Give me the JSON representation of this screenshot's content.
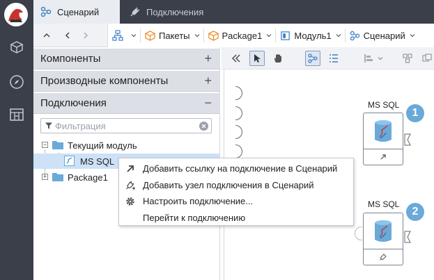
{
  "tabs": [
    {
      "label": "Сценарий",
      "icon": "scenario-icon",
      "active": true
    },
    {
      "label": "Подключения",
      "icon": "plug-icon",
      "active": false
    }
  ],
  "rail": {
    "icons": [
      "app-logo",
      "package-icon",
      "compass-icon",
      "table-grid-icon"
    ]
  },
  "breadcrumb": [
    {
      "label": "",
      "icon": "hierarchy-icon"
    },
    {
      "label": "Пакеты",
      "icon": "package-icon"
    },
    {
      "label": "Package1",
      "icon": "package-icon"
    },
    {
      "label": "Модуль1",
      "icon": "module-icon"
    },
    {
      "label": "Сценарий",
      "icon": "scenario-icon"
    }
  ],
  "panel": {
    "sections": {
      "components": "Компоненты",
      "derived": "Производные компоненты",
      "connections": "Подключения"
    },
    "filter_placeholder": "Фильтрация",
    "tree": {
      "current_module": "Текущий модуль",
      "ms_sql": "MS SQL",
      "package1": "Package1"
    }
  },
  "context_menu": {
    "items": [
      "Добавить ссылку на подключение в Сценарий",
      "Добавить узел подключения в Сценарий",
      "Настроить подключение...",
      "Перейти к подключению"
    ]
  },
  "canvas": {
    "nodes": [
      {
        "label": "MS SQL",
        "badge": "1"
      },
      {
        "label": "MS SQL",
        "badge": "2"
      }
    ]
  },
  "colors": {
    "rail": "#3a3f4a",
    "accent": "#6aa9d8",
    "selection": "#cde1f7",
    "orange": "#e8891c"
  }
}
